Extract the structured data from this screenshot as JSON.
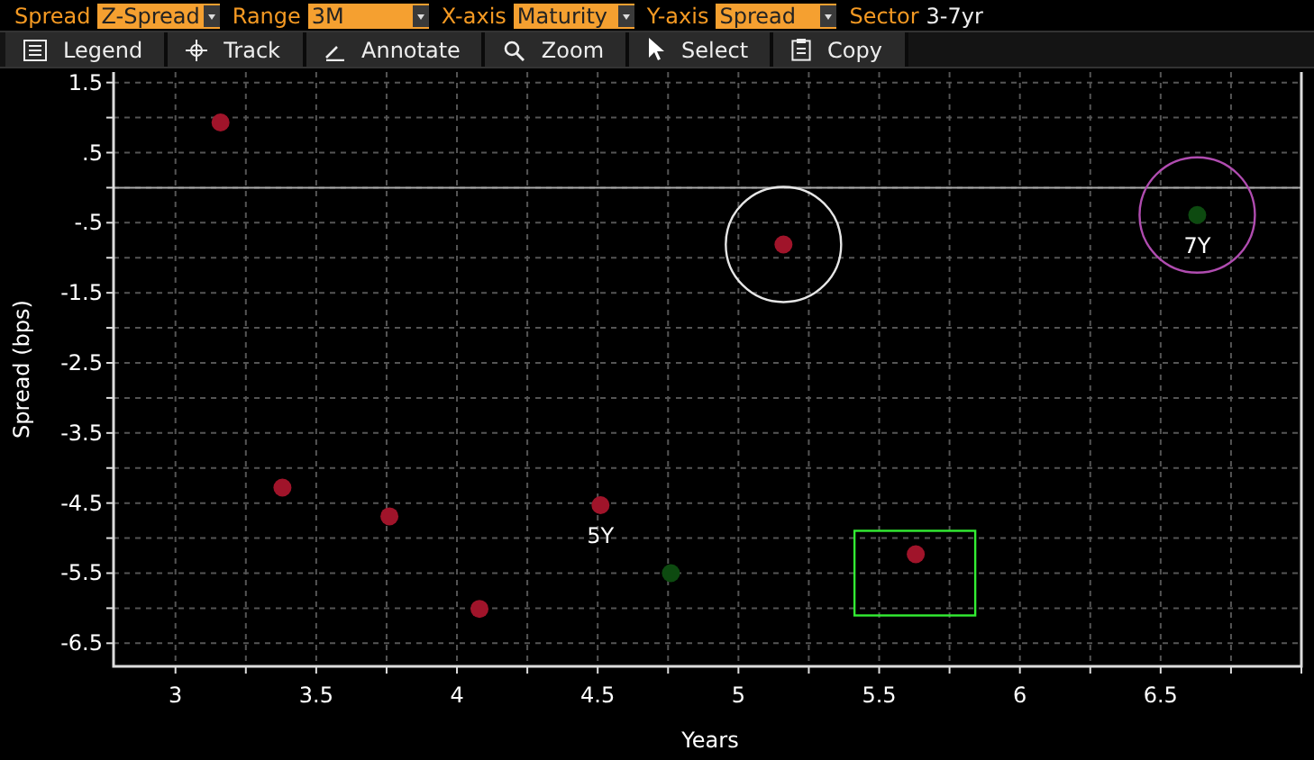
{
  "filters": [
    {
      "label": "Spread",
      "value": "Z-Spread",
      "kind": "dropdown"
    },
    {
      "label": "Range",
      "value": "3M",
      "kind": "dropdown"
    },
    {
      "label": "X-axis",
      "value": "Maturity",
      "kind": "dropdown"
    },
    {
      "label": "Y-axis",
      "value": "Spread",
      "kind": "dropdown"
    },
    {
      "label": "Sector",
      "value": "3-7yr",
      "kind": "text"
    }
  ],
  "toolbar": [
    {
      "label": "Legend",
      "kind": "legend"
    },
    {
      "label": "Track",
      "kind": "track"
    },
    {
      "label": "Annotate",
      "kind": "annotate"
    },
    {
      "label": "Zoom",
      "kind": "zoom"
    },
    {
      "label": "Select",
      "kind": "select"
    },
    {
      "label": "Copy",
      "kind": "copy"
    }
  ],
  "chart_data": {
    "type": "scatter",
    "xlabel": "Years",
    "ylabel": "Spread (bps)",
    "grid": true,
    "xlim": [
      2.78,
      7.0
    ],
    "ylim": [
      -6.83,
      1.65
    ],
    "xticks": [
      3,
      3.5,
      4,
      4.5,
      5,
      5.5,
      6,
      6.5
    ],
    "yticks": [
      {
        "value": 1.5,
        "label": "1.5"
      },
      {
        "value": 0.5,
        "label": ".5"
      },
      {
        "value": -0.5,
        "label": "-.5"
      },
      {
        "value": -1.5,
        "label": "-1.5"
      },
      {
        "value": -2.5,
        "label": "-2.5"
      },
      {
        "value": -3.5,
        "label": "-3.5"
      },
      {
        "value": -4.5,
        "label": "-4.5"
      },
      {
        "value": -5.5,
        "label": "-5.5"
      },
      {
        "value": -6.5,
        "label": "-6.5"
      }
    ],
    "series": [
      {
        "color": "#a0142a",
        "x": [
          3.16,
          3.38,
          3.76,
          4.08,
          4.51,
          5.16,
          5.63
        ],
        "values": [
          0.93,
          -4.28,
          -4.69,
          -6.01,
          -4.53,
          -0.81,
          -5.23
        ]
      },
      {
        "color": "#0d4a10",
        "x": [
          4.76,
          6.63
        ],
        "values": [
          -5.5,
          -0.39
        ]
      }
    ],
    "annotations": [
      "5Y",
      "7Y"
    ]
  },
  "markups": [
    {
      "kind": "circle",
      "color": "#e6e6e6"
    },
    {
      "kind": "circle",
      "color": "#b04cb0"
    },
    {
      "kind": "rect",
      "color": "#33ee33"
    }
  ]
}
